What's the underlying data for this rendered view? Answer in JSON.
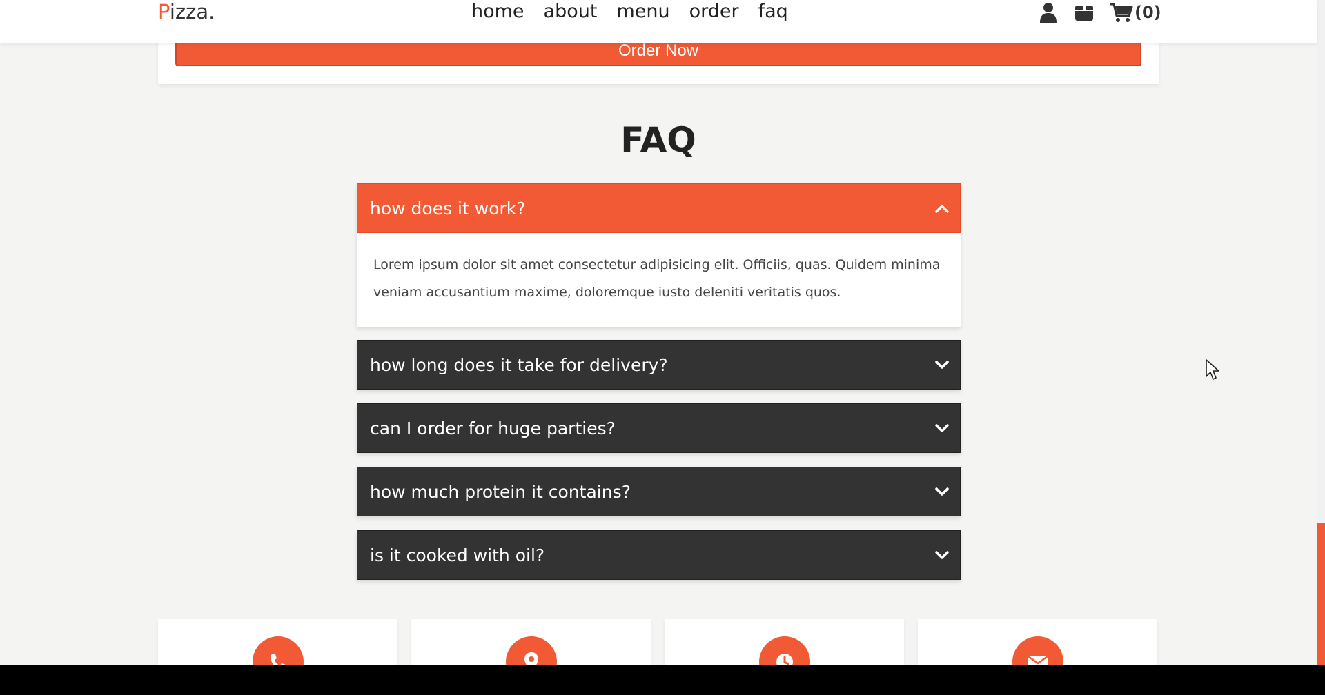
{
  "header": {
    "logo_first": "P",
    "logo_rest": "izza.",
    "nav": [
      "home",
      "about",
      "menu",
      "order",
      "faq"
    ],
    "icons": [
      "user-icon",
      "box-icon",
      "cart-icon"
    ],
    "cart_count": "(0)"
  },
  "order_button": "Order Now",
  "faq": {
    "title": "FAQ",
    "items": [
      {
        "question": "how does it work?",
        "answer": "Lorem ipsum dolor sit amet consectetur adipisicing elit. Officiis, quas. Quidem minima veniam accusantium maxime, doloremque iusto deleniti veritatis quos.",
        "open": true
      },
      {
        "question": "how long does it take for delivery?",
        "open": false
      },
      {
        "question": "can I order for huge parties?",
        "open": false
      },
      {
        "question": "how much protein it contains?",
        "open": false
      },
      {
        "question": "is it cooked with oil?",
        "open": false
      }
    ]
  },
  "info_cards": [
    "phone-icon",
    "location-icon",
    "clock-icon",
    "envelope-icon"
  ],
  "colors": {
    "accent": "#f15a34",
    "dark": "#323332",
    "background": "#f4f4f3"
  }
}
